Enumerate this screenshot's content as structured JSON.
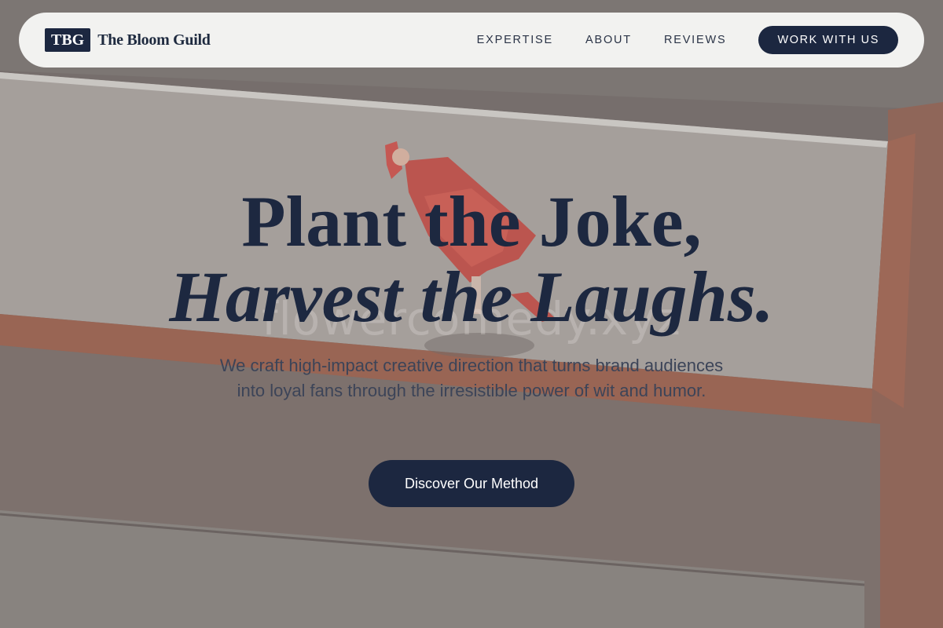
{
  "watermark": "flowercomedy.xyz",
  "brand": {
    "mark": "TBG",
    "name": "The Bloom Guild"
  },
  "nav": {
    "links": [
      "EXPERTISE",
      "ABOUT",
      "REVIEWS"
    ],
    "cta": "WORK WITH US"
  },
  "hero": {
    "line1": "Plant the Joke,",
    "line2": "Harvest the Laughs.",
    "subtitle": "We craft high-impact creative direction that turns brand audiences into loyal fans through the irresistible power of wit and humor.",
    "button": "Discover Our Method"
  },
  "colors": {
    "navy": "#1c2740",
    "nav_bg": "#f7f7f6",
    "subtitle": "#3c4458"
  }
}
